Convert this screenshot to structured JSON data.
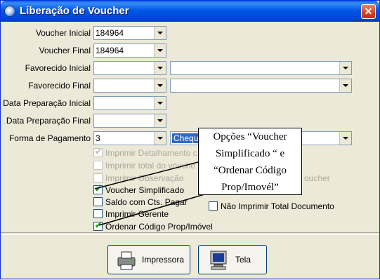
{
  "window": {
    "title": "Liberação de Voucher",
    "close_symbol": "✕"
  },
  "fields": {
    "voucher_inicial": {
      "label": "Voucher Inicial",
      "value": "184964"
    },
    "voucher_final": {
      "label": "Voucher Final",
      "value": "184964"
    },
    "favorecido_inicial": {
      "label": "Favorecido Inicial",
      "code": "",
      "name": ""
    },
    "favorecido_final": {
      "label": "Favorecido Final",
      "code": "",
      "name": ""
    },
    "data_prep_inicial": {
      "label": "Data Preparação Inicial",
      "value": ""
    },
    "data_prep_final": {
      "label": "Data Preparação Final",
      "value": ""
    },
    "forma_pagamento": {
      "label": "Forma de Pagamento",
      "code": "3",
      "name": "Chequ"
    }
  },
  "checkboxes": {
    "imprimir_detalhamento": {
      "label": "Imprimir Detalhamento c",
      "checked": true,
      "enabled": false
    },
    "imprimir_total_voucher": {
      "label": "Imprimir total do vouche",
      "checked": false,
      "enabled": false
    },
    "imprimir_observacao": {
      "label": "Imprimir Observação",
      "checked": false,
      "enabled": false
    },
    "imprimir_voucher_right": {
      "label": "oucher",
      "checked": false,
      "enabled": false
    },
    "voucher_simplificado": {
      "label": "Voucher Simplificado",
      "checked": true,
      "enabled": true
    },
    "saldo_cts_pagar": {
      "label": "Saldo com Cts. Pagar",
      "checked": false,
      "enabled": true
    },
    "imprimir_gerente": {
      "label": "Imprimir Gerente",
      "checked": false,
      "enabled": true
    },
    "ordenar_codigo": {
      "label": "Ordenar Código Prop/Imóvel",
      "checked": true,
      "enabled": true
    },
    "nao_imprimir_total": {
      "label": "Não Imprimir Total Documento",
      "checked": false,
      "enabled": true
    }
  },
  "buttons": {
    "impressora": {
      "label": "Impressora"
    },
    "tela": {
      "label": "Tela"
    }
  },
  "callout": {
    "line1": "Opções “Voucher",
    "line2": "Simplificado “ e",
    "line3": "“Ordenar Código",
    "line4": "Prop/Imovél”"
  },
  "colors": {
    "titlebar": "#0058e6",
    "check": "#21a121",
    "selection": "#316ac5"
  }
}
